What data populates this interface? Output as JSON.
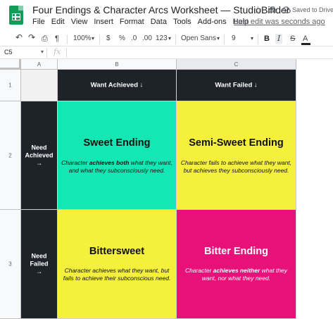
{
  "app": {
    "title": "Four Endings & Character Arcs Worksheet — StudioBinder",
    "saved_status": "Saved to Drive",
    "last_edit": "Last edit was seconds ago",
    "icons": [
      "sheets-logo-icon",
      "star-icon",
      "move-to-drive-icon",
      "cloud-done-icon"
    ]
  },
  "menu": [
    "File",
    "Edit",
    "View",
    "Insert",
    "Format",
    "Data",
    "Tools",
    "Add-ons",
    "Help"
  ],
  "toolbar": {
    "undo_icon": "↶",
    "redo_icon": "↷",
    "print_icon": "⎙",
    "paint_format_icon": "¶",
    "zoom": "100%",
    "zoom_caret": "▾",
    "currency": "$",
    "percent": "%",
    "decimal_decrease": ".0",
    "decimal_increase": ".00",
    "more_formats": "123",
    "more_formats_caret": "▾",
    "font": "Open Sans",
    "font_caret": "▾",
    "font_size": "9",
    "font_size_caret": "▾",
    "bold": "B",
    "italic": "I",
    "strikethrough": "S",
    "text_color": "A"
  },
  "formula_bar": {
    "cell_ref": "C5",
    "cell_ref_caret": "▾",
    "fx": "fx",
    "value": ""
  },
  "columns": [
    "A",
    "B",
    "C"
  ],
  "rows": [
    "1",
    "2",
    "3"
  ],
  "sheet": {
    "header_b": "Want Achieved ↓",
    "header_c": "Want Failed ↓",
    "row2_side": [
      "Need",
      "Achieved",
      "→"
    ],
    "row3_side": [
      "Need",
      "Failed",
      "→"
    ],
    "sweet": {
      "title": "Sweet Ending",
      "desc_pre": "Character ",
      "desc_bold": "achieves both",
      "desc_post": " what they want, and what they subconsciously need."
    },
    "semi_sweet": {
      "title": "Semi-Sweet Ending",
      "desc": "Character fails to achieve what they want, but achieves they subconsciously need."
    },
    "bittersweet": {
      "title": "Bittersweet",
      "desc": "Character achieves what they want, but fails to achieve their subconscious need."
    },
    "bitter": {
      "title": "Bitter Ending",
      "desc_pre": "Character ",
      "desc_bold": "achieves neither",
      "desc_post": " what they want, nor what they need."
    }
  },
  "colors": {
    "dark": "#1e2229",
    "mint": "#13e8b4",
    "yellow": "#f4f03c",
    "magenta": "#e8117a",
    "sheets_green": "#0f9d58"
  }
}
